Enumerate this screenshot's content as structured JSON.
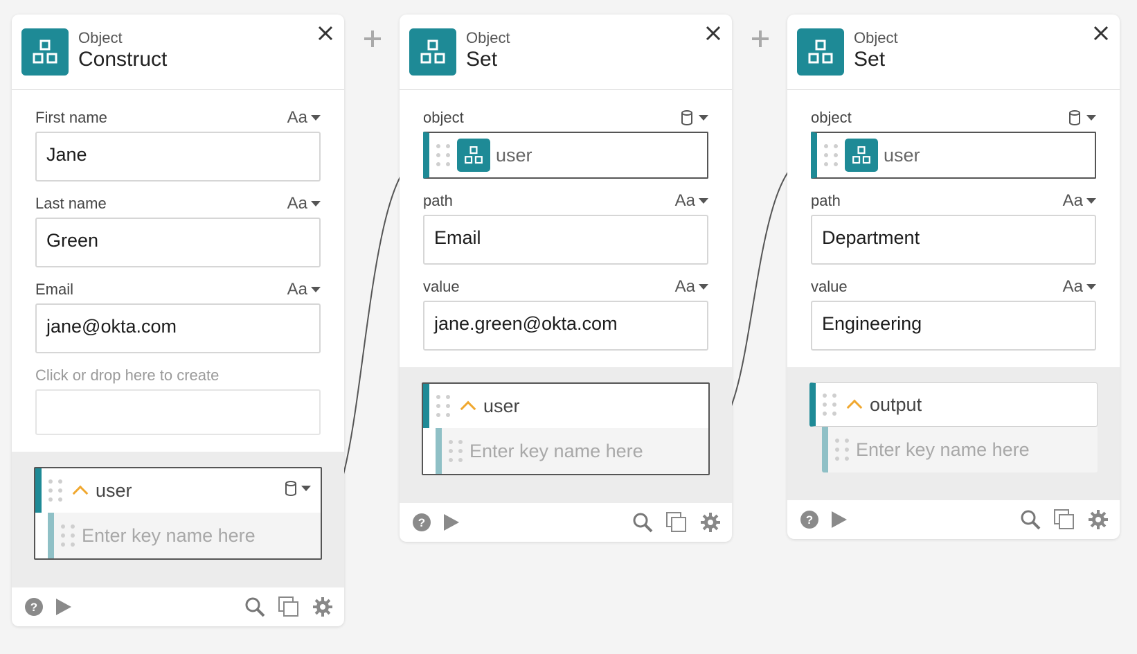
{
  "accent": "#1e8a96",
  "cards": [
    {
      "kicker": "Object",
      "title": "Construct",
      "fields": [
        {
          "label": "First name",
          "type": "Aa",
          "value": "Jane"
        },
        {
          "label": "Last name",
          "type": "Aa",
          "value": "Green"
        },
        {
          "label": "Email",
          "type": "Aa",
          "value": "jane@okta.com"
        }
      ],
      "create_hint": "Click or drop here to create",
      "output": {
        "label": "user",
        "key_placeholder": "Enter key name here"
      }
    },
    {
      "kicker": "Object",
      "title": "Set",
      "object_label": "object",
      "object_ref": "user",
      "path_label": "path",
      "path_type": "Aa",
      "path_value": "Email",
      "value_label": "value",
      "value_type": "Aa",
      "value_value": "jane.green@okta.com",
      "output": {
        "label": "user",
        "key_placeholder": "Enter key name here"
      }
    },
    {
      "kicker": "Object",
      "title": "Set",
      "object_label": "object",
      "object_ref": "user",
      "path_label": "path",
      "path_type": "Aa",
      "path_value": "Department",
      "value_label": "value",
      "value_type": "Aa",
      "value_value": "Engineering",
      "output": {
        "label": "output",
        "key_placeholder": "Enter key name here"
      }
    }
  ],
  "icons": {
    "card": "object-icon",
    "close": "close-icon",
    "plus": "add-card-icon",
    "help": "help-icon",
    "play": "play-icon",
    "search": "search-icon",
    "copy": "copy-icon",
    "settings": "gear-icon",
    "db": "database-icon"
  }
}
